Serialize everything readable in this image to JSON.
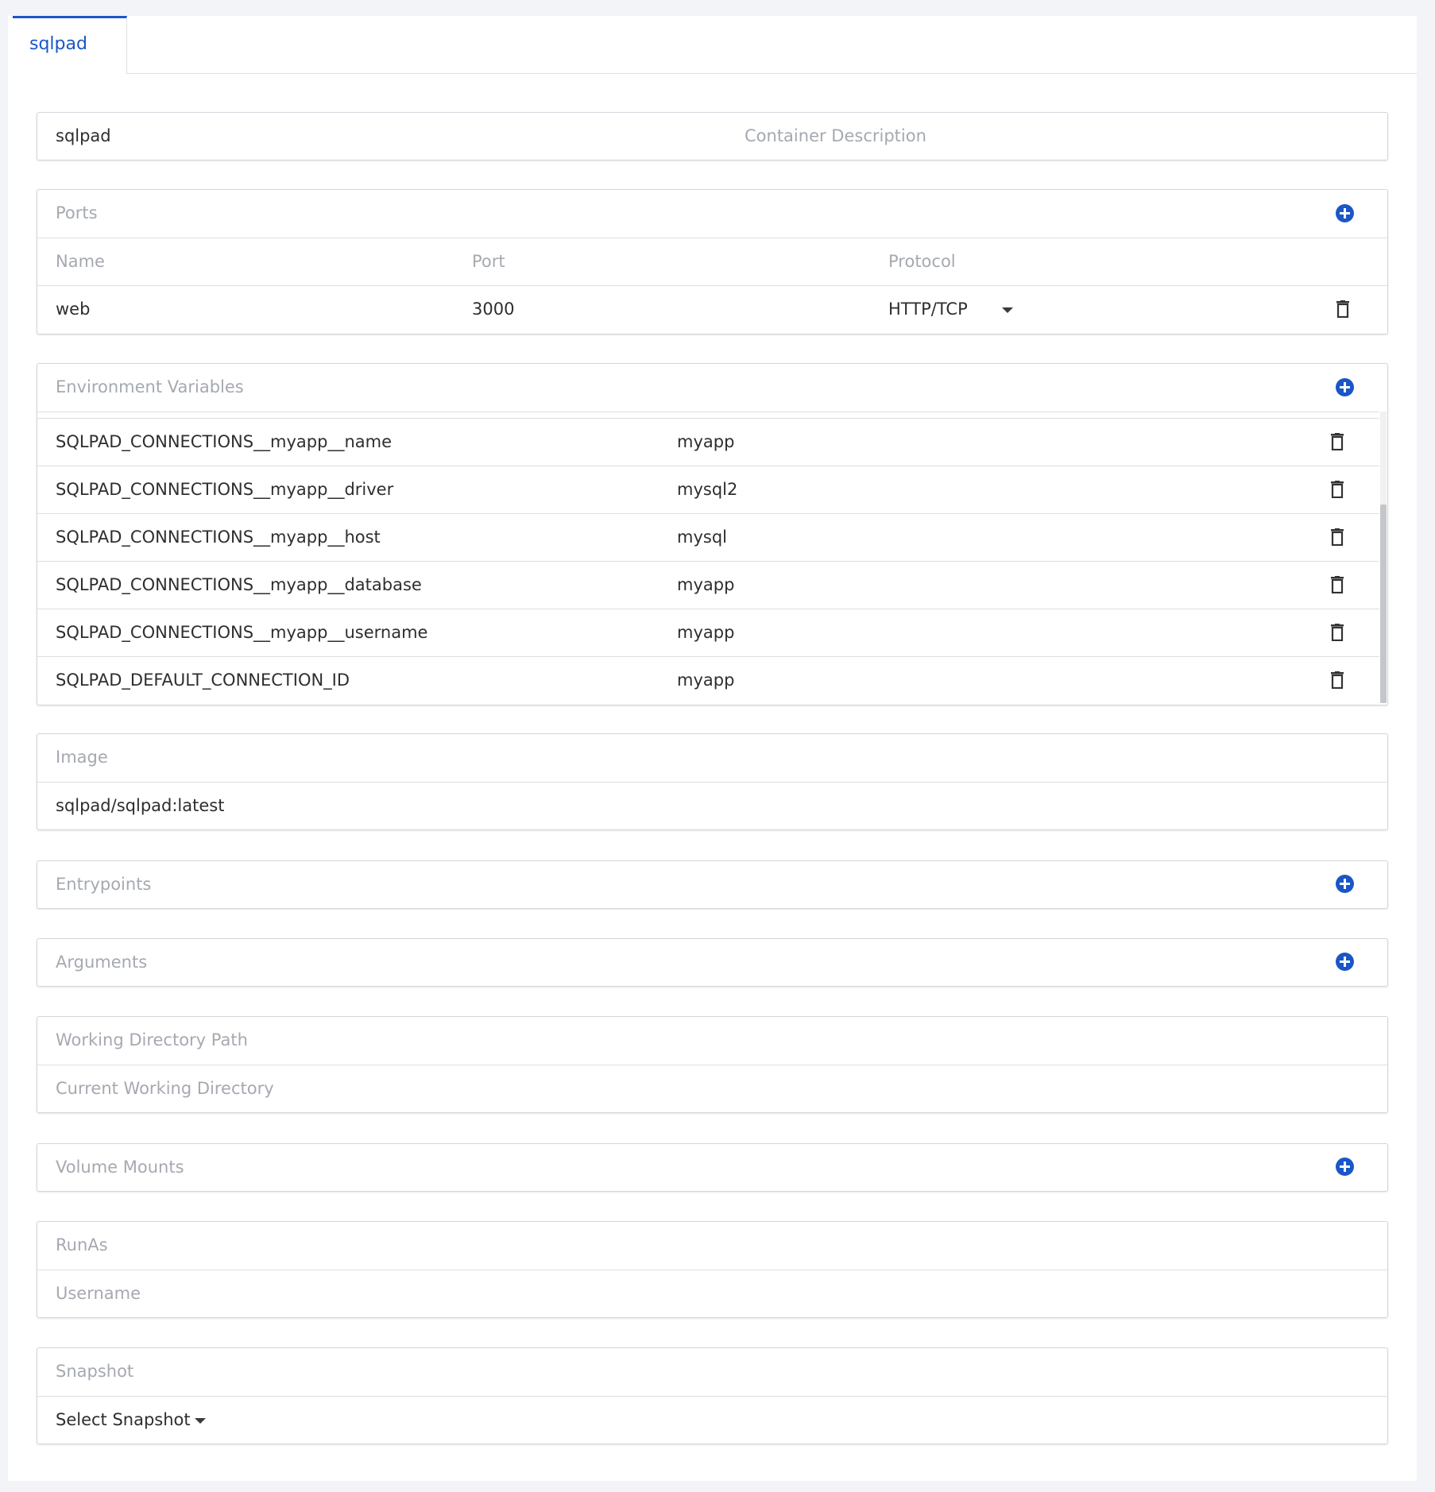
{
  "tab": {
    "label": "sqlpad"
  },
  "container": {
    "name": "sqlpad",
    "description_placeholder": "Container Description"
  },
  "ports": {
    "title": "Ports",
    "columns": [
      "Name",
      "Port",
      "Protocol"
    ],
    "rows": [
      {
        "name": "web",
        "port": "3000",
        "protocol": "HTTP/TCP"
      }
    ]
  },
  "env": {
    "title": "Environment Variables",
    "rows": [
      {
        "key": "SQLPAD_CONNECTIONS__myapp__name",
        "value": "myapp"
      },
      {
        "key": "SQLPAD_CONNECTIONS__myapp__driver",
        "value": "mysql2"
      },
      {
        "key": "SQLPAD_CONNECTIONS__myapp__host",
        "value": "mysql"
      },
      {
        "key": "SQLPAD_CONNECTIONS__myapp__database",
        "value": "myapp"
      },
      {
        "key": "SQLPAD_CONNECTIONS__myapp__username",
        "value": "myapp"
      },
      {
        "key": "SQLPAD_DEFAULT_CONNECTION_ID",
        "value": "myapp"
      }
    ]
  },
  "image": {
    "title": "Image",
    "value": "sqlpad/sqlpad:latest"
  },
  "entrypoints": {
    "title": "Entrypoints"
  },
  "arguments": {
    "title": "Arguments"
  },
  "workdir": {
    "title": "Working Directory Path",
    "placeholder": "Current Working Directory"
  },
  "volumes": {
    "title": "Volume Mounts"
  },
  "runas": {
    "title": "RunAs",
    "placeholder": "Username"
  },
  "snapshot": {
    "title": "Snapshot",
    "select_label": "Select Snapshot"
  },
  "colors": {
    "accent": "#1a56c6",
    "placeholder": "#a5a9b0",
    "border": "#d3d6db"
  },
  "icons": {
    "add": "plus-circle-icon",
    "delete": "trash-icon",
    "dropdown": "caret-down-icon"
  }
}
